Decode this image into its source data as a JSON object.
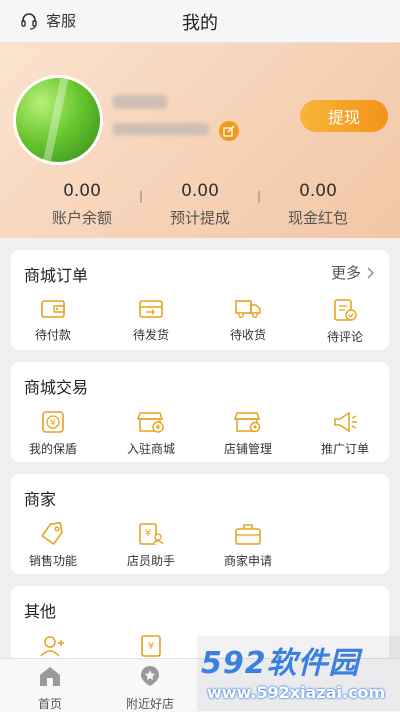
{
  "topbar": {
    "service_label": "客服",
    "title": "我的"
  },
  "profile": {
    "withdraw_label": "提现"
  },
  "stats": [
    {
      "value": "0.00",
      "label": "账户余额"
    },
    {
      "value": "0.00",
      "label": "预计提成"
    },
    {
      "value": "0.00",
      "label": "现金红包"
    }
  ],
  "orders": {
    "title": "商城订单",
    "more": "更多",
    "items": [
      {
        "label": "待付款",
        "icon": "wallet-icon"
      },
      {
        "label": "待发货",
        "icon": "package-icon"
      },
      {
        "label": "待收货",
        "icon": "truck-icon"
      },
      {
        "label": "待评论",
        "icon": "review-icon"
      }
    ]
  },
  "trade": {
    "title": "商城交易",
    "items": [
      {
        "label": "我的保盾",
        "icon": "yuan-shield-icon"
      },
      {
        "label": "入驻商城",
        "icon": "shop-join-icon"
      },
      {
        "label": "店铺管理",
        "icon": "shop-manage-icon"
      },
      {
        "label": "推广订单",
        "icon": "megaphone-icon"
      }
    ]
  },
  "merchant": {
    "title": "商家",
    "items": [
      {
        "label": "销售功能",
        "icon": "tag-icon"
      },
      {
        "label": "店员助手",
        "icon": "assistant-icon"
      },
      {
        "label": "商家申请",
        "icon": "briefcase-icon"
      }
    ]
  },
  "other": {
    "title": "其他"
  },
  "tabbar": [
    {
      "label": "首页",
      "icon": "home-icon"
    },
    {
      "label": "附近好店",
      "icon": "nearby-icon"
    }
  ],
  "watermark": {
    "brand": "592软件园",
    "url": "www.592xiazai.com"
  },
  "colors": {
    "accent": "#f29418",
    "icon_yellow": "#e6a21b"
  }
}
